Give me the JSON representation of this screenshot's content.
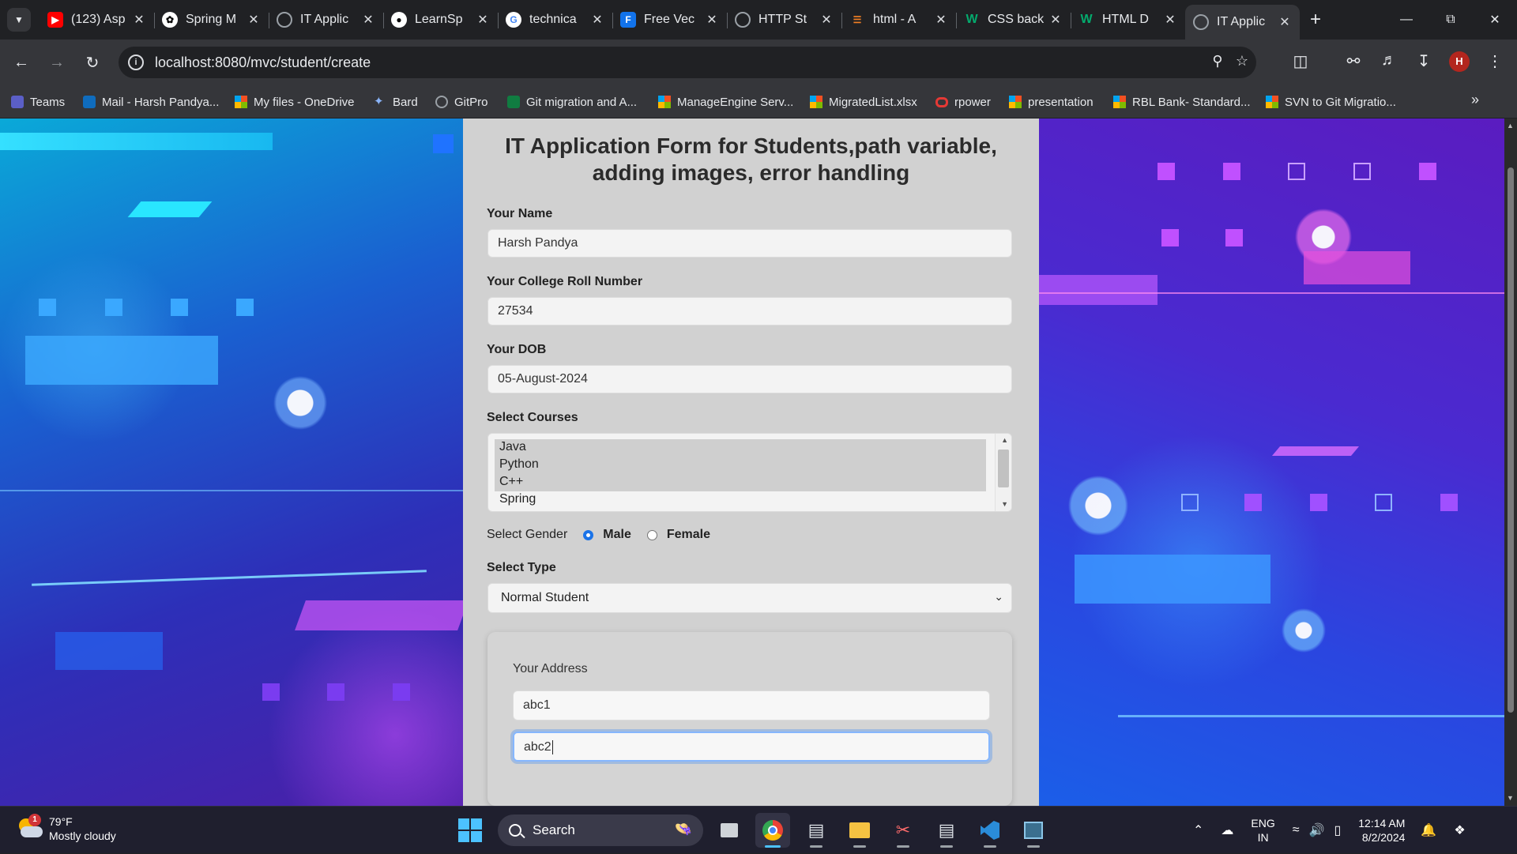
{
  "browser": {
    "tabs": [
      {
        "title": "(123) Asp",
        "favicon": "youtube-icon",
        "color": "#ff0000"
      },
      {
        "title": "Spring M",
        "favicon": "openai-icon",
        "color": "#ffffff"
      },
      {
        "title": "IT Applic",
        "favicon": "globe-icon",
        "color": "#9aa0a6"
      },
      {
        "title": "LearnSp",
        "favicon": "github-icon",
        "color": "#ffffff"
      },
      {
        "title": "technica",
        "favicon": "google-icon",
        "color": "#4285f4"
      },
      {
        "title": "Free Vec",
        "favicon": "freepik-icon",
        "color": "#1273eb"
      },
      {
        "title": "HTTP St",
        "favicon": "globe-icon",
        "color": "#9aa0a6"
      },
      {
        "title": "html - A",
        "favicon": "stackoverflow-icon",
        "color": "#f48024"
      },
      {
        "title": "CSS back",
        "favicon": "w3schools-icon",
        "color": "#04aa6d"
      },
      {
        "title": "HTML D",
        "favicon": "w3schools-icon",
        "color": "#04aa6d"
      },
      {
        "title": "IT Applic",
        "favicon": "globe-icon",
        "color": "#9aa0a6",
        "active": true
      }
    ],
    "url": "localhost:8080/mvc/student/create",
    "profile_initial": "H",
    "bookmarks": [
      {
        "label": "Teams",
        "icon": "teams-icon"
      },
      {
        "label": "Mail - Harsh Pandya...",
        "icon": "outlook-icon"
      },
      {
        "label": "My files - OneDrive",
        "icon": "microsoft-icon"
      },
      {
        "label": "Bard",
        "icon": "bard-icon"
      },
      {
        "label": "GitPro",
        "icon": "globe-icon"
      },
      {
        "label": "Git migration and A...",
        "icon": "excel-icon"
      },
      {
        "label": "ManageEngine Serv...",
        "icon": "microsoft-icon"
      },
      {
        "label": "MigratedList.xlsx",
        "icon": "microsoft-icon"
      },
      {
        "label": "rpower",
        "icon": "rpower-icon"
      },
      {
        "label": "presentation",
        "icon": "microsoft-icon"
      },
      {
        "label": "RBL Bank- Standard...",
        "icon": "microsoft-icon"
      },
      {
        "label": "SVN to Git Migratio...",
        "icon": "microsoft-icon"
      }
    ]
  },
  "form": {
    "title": "IT Application Form for Students,path variable, adding images, error handling",
    "name_label": "Your Name",
    "name_value": "Harsh Pandya",
    "roll_label": "Your College Roll Number",
    "roll_value": "27534",
    "dob_label": "Your DOB",
    "dob_value": "05-August-2024",
    "courses_label": "Select Courses",
    "courses": [
      "Java",
      "Python",
      "C++",
      "Spring"
    ],
    "selected_courses": [
      "Java",
      "Python",
      "C++"
    ],
    "gender_label": "Select Gender",
    "gender_options": [
      "Male",
      "Female"
    ],
    "gender_selected": "Male",
    "type_label": "Select Type",
    "type_value": "Normal Student",
    "address_label": "Your Address",
    "address_line1": "abc1",
    "address_line2": "abc2"
  },
  "taskbar": {
    "weather_temp": "79°F",
    "weather_desc": "Mostly cloudy",
    "weather_badge": "1",
    "search_label": "Search",
    "lang_primary": "ENG",
    "lang_secondary": "IN",
    "time": "12:14 AM",
    "date": "8/2/2024",
    "apps": [
      "file-explorer-icon",
      "chrome-icon",
      "ide-icon",
      "folder-icon",
      "snipping-tool-icon",
      "ide-icon",
      "vscode-icon",
      "terminal-icon"
    ]
  }
}
